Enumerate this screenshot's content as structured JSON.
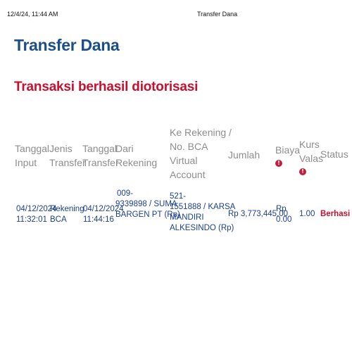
{
  "print_header": {
    "datetime": "12/4/24, 11:44 AM",
    "title": "Transfer Dana"
  },
  "page": {
    "title": "Transfer Dana",
    "success_message": "Transaksi berhasil diotorisasi"
  },
  "table": {
    "headers": {
      "tanggal_input": [
        "Tanggal",
        "Input"
      ],
      "jenis_transfer": [
        "Jenis",
        "Transfer"
      ],
      "tanggal_transfer": [
        "Tanggal",
        "Transfer"
      ],
      "dari_rekening": [
        "Dari",
        "Rekening"
      ],
      "ke_rekening": [
        "Ke Rekening /",
        "No. BCA",
        "Virtual",
        "Account"
      ],
      "jumlah": "Jumlah",
      "biaya": "Biaya",
      "kurs_valas": [
        "Kurs",
        "Valas"
      ],
      "status": "Status"
    },
    "info_icon": "info-icon",
    "row": {
      "tanggal_input": [
        "04/12/2024",
        "11:32:01"
      ],
      "jenis_transfer": [
        "Rekening",
        "BCA"
      ],
      "tanggal_transfer": [
        "04/12/2024",
        "11:44:16"
      ],
      "dari_rekening": [
        "009-",
        "9339898 / SUMA",
        "BARGEN PT (Rp)"
      ],
      "ke_rekening": [
        "521-",
        "1551888 / KARSA",
        "MANDIRI",
        "ALKESINDO (Rp)"
      ],
      "jumlah": "Rp 3,773,445.00",
      "biaya": [
        "Rp",
        "0.00"
      ],
      "kurs_valas": "1.00",
      "status": "Berhasi"
    }
  },
  "colors": {
    "title": "#1b4f8a",
    "success": "#c8102e",
    "header_text": "#8d8d8d",
    "cell_text": "#1c3f8f",
    "info_icon": "#c41e3a"
  }
}
